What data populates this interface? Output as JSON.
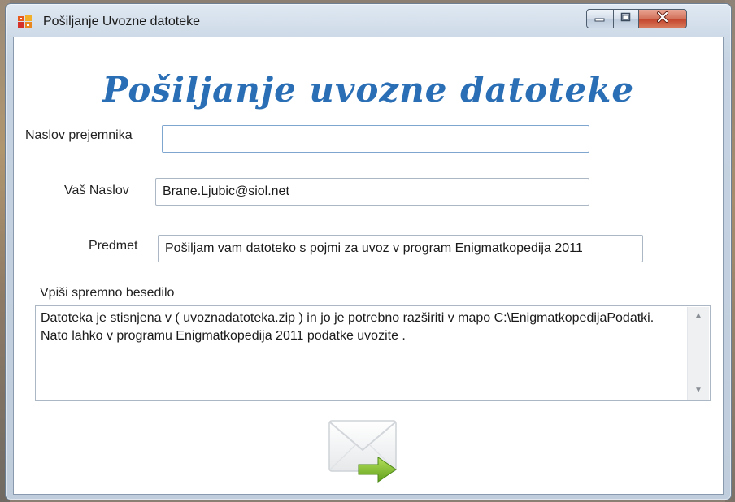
{
  "window": {
    "title": "Pošiljanje Uvozne datoteke"
  },
  "form": {
    "heading": "Pošiljanje uvozne datoteke",
    "recipient": {
      "label": "Naslov prejemnika",
      "value": ""
    },
    "sender": {
      "label": "Vaš Naslov",
      "value": "Brane.Ljubic@siol.net"
    },
    "subject": {
      "label": "Predmet",
      "value": "Pošiljam vam datoteko s pojmi za uvoz v program Enigmatkopedija 2011"
    },
    "message": {
      "label": "Vpiši spremno besedilo",
      "value": "Datoteka je stisnjena v ( uvoznadatoteka.zip ) in jo je potrebno razširiti v mapo C:\\EnigmatkopedijaPodatki.  Nato lahko v programu Enigmatkopedija 2011 podatke uvozite ."
    }
  },
  "icons": {
    "app": "app-icon",
    "send": "send-mail-icon"
  },
  "colors": {
    "heading": "#2a6fb5",
    "close_button": "#c2432b",
    "send_arrow": "#7cbf2a"
  }
}
